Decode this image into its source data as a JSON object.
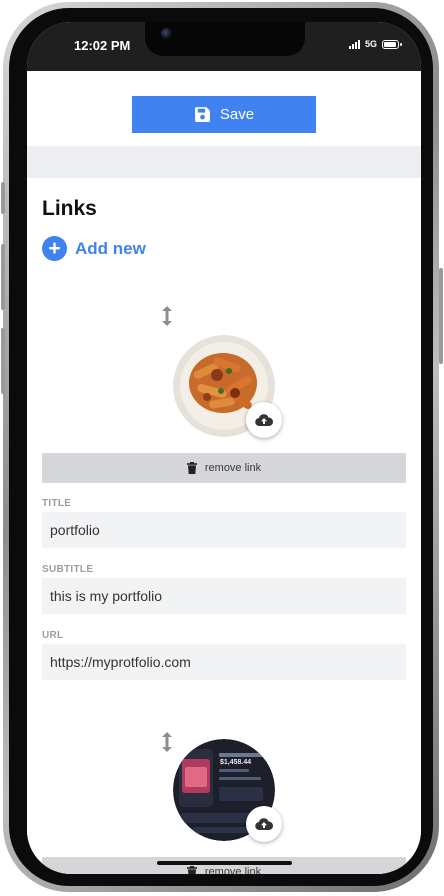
{
  "status_bar": {
    "time": "12:02 PM",
    "network": "5G"
  },
  "header": {
    "save_label": "Save"
  },
  "links_section": {
    "title": "Links",
    "add_new_label": "Add new"
  },
  "links": [
    {
      "thumbnail_icon": "pasta-dish-photo",
      "remove_label": "remove link",
      "title_label": "TITLE",
      "title_value": "portfolio",
      "subtitle_label": "SUBTITLE",
      "subtitle_value": "this is my portfolio",
      "url_label": "URL",
      "url_value": "https://myprotfolio.com"
    },
    {
      "thumbnail_icon": "finance-app-screenshot",
      "thumbnail_amount": "$1,458.44",
      "remove_label": "remove link"
    }
  ],
  "colors": {
    "accent": "#3f82f0",
    "remove_bar": "#d4d6da",
    "input_bg": "#f2f3f5"
  }
}
